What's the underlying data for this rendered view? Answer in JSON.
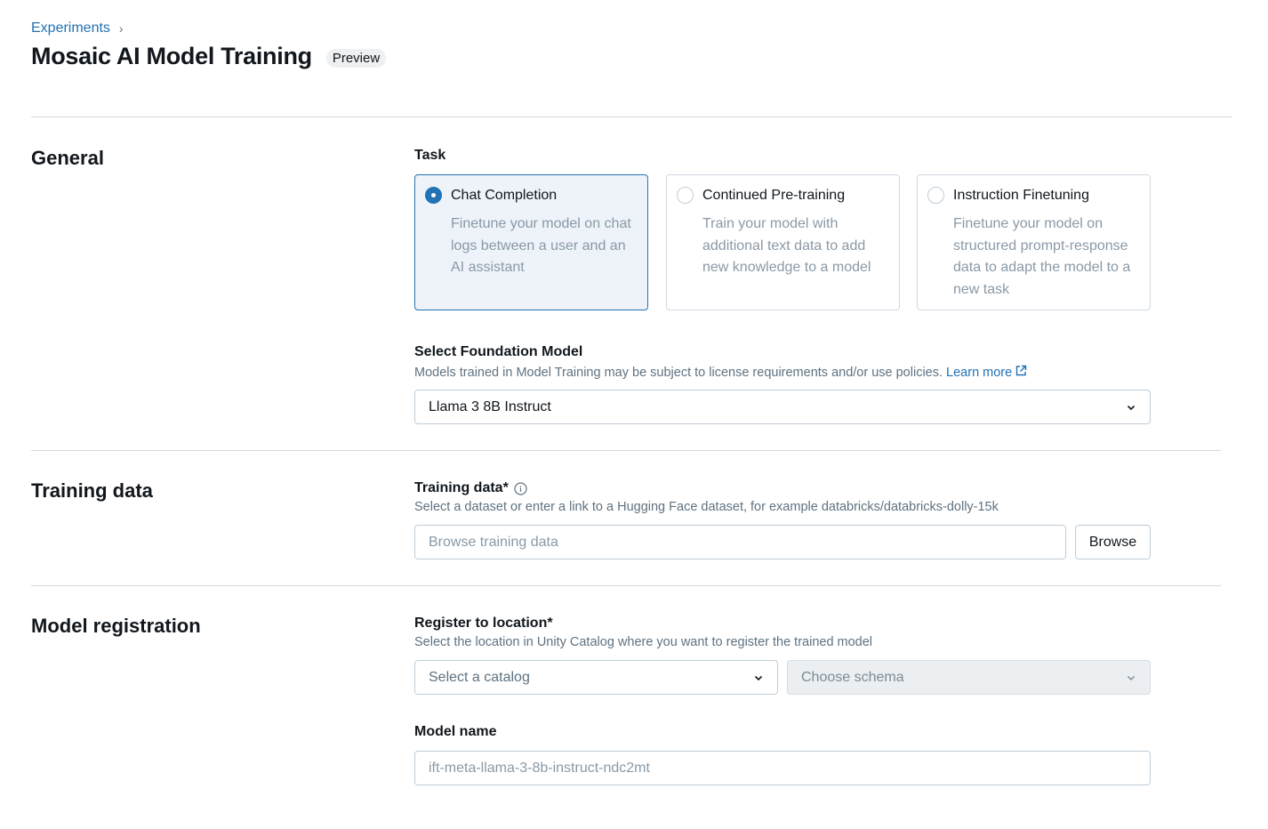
{
  "breadcrumb": {
    "parent": "Experiments",
    "separator": "›"
  },
  "header": {
    "title": "Mosaic AI Model Training",
    "badge": "Preview"
  },
  "sections": {
    "general": "General",
    "training_data": "Training data",
    "model_registration": "Model registration"
  },
  "task": {
    "label": "Task",
    "options": [
      {
        "title": "Chat Completion",
        "description": "Finetune your model on chat logs between a user and an AI assistant",
        "selected": true
      },
      {
        "title": "Continued Pre-training",
        "description": "Train your model with additional text data to add new knowledge to a model",
        "selected": false
      },
      {
        "title": "Instruction Finetuning",
        "description": "Finetune your model on structured prompt-response data to adapt the model to a new task",
        "selected": false
      }
    ]
  },
  "foundation_model": {
    "label": "Select Foundation Model",
    "help": "Models trained in Model Training may be subject to license requirements and/or use policies.",
    "learn_more": "Learn more",
    "value": "Llama 3 8B Instruct"
  },
  "training_data": {
    "label": "Training data*",
    "help": "Select a dataset or enter a link to a Hugging Face dataset, for example databricks/databricks-dolly-15k",
    "placeholder": "Browse training data",
    "browse_button": "Browse"
  },
  "register_location": {
    "label": "Register to location*",
    "help": "Select the location in Unity Catalog where you want to register the trained model",
    "catalog_placeholder": "Select a catalog",
    "schema_placeholder": "Choose schema"
  },
  "model_name": {
    "label": "Model name",
    "placeholder": "ift-meta-llama-3-8b-instruct-ndc2mt"
  },
  "colors": {
    "accent": "#2272b4",
    "selected_bg": "#edf3f9",
    "border": "#c0cdd8",
    "muted_text": "#5f7281"
  }
}
